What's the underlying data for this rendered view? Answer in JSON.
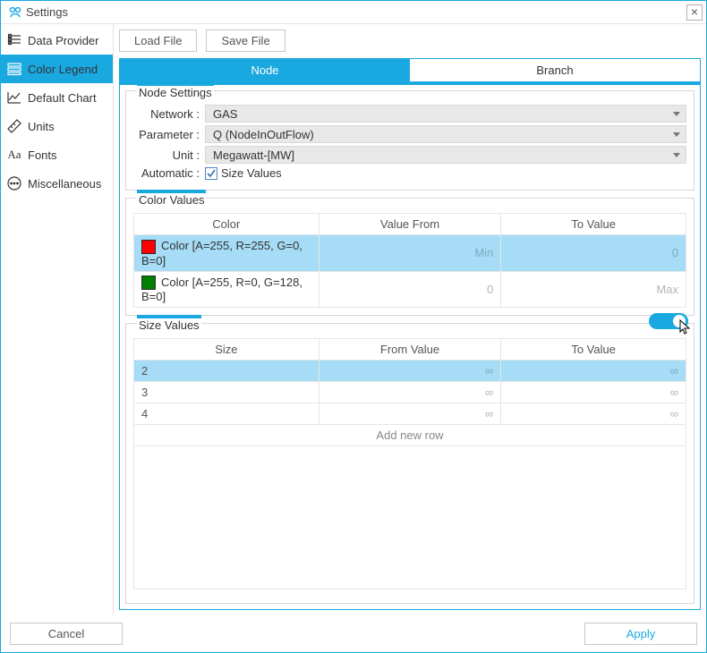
{
  "window": {
    "title": "Settings"
  },
  "sidebar": {
    "items": [
      {
        "label": "Data Provider"
      },
      {
        "label": "Color Legend"
      },
      {
        "label": "Default Chart"
      },
      {
        "label": "Units"
      },
      {
        "label": "Fonts"
      },
      {
        "label": "Miscellaneous"
      }
    ],
    "active_index": 1
  },
  "toolbar": {
    "load": "Load File",
    "save": "Save File"
  },
  "tabs": {
    "node": "Node",
    "branch": "Branch",
    "active": "node"
  },
  "node_settings": {
    "title": "Node Settings",
    "network_label": "Network :",
    "network_value": "GAS",
    "parameter_label": "Parameter :",
    "parameter_value": "Q (NodeInOutFlow)",
    "unit_label": "Unit :",
    "unit_value": "Megawatt-[MW]",
    "automatic_label": "Automatic :",
    "automatic_check_label": "Size Values",
    "automatic_checked": true
  },
  "color_values": {
    "title": "Color Values",
    "headers": {
      "color": "Color",
      "from": "Value From",
      "to": "To Value"
    },
    "rows": [
      {
        "swatch": "#ff0000",
        "name": "Color [A=255, R=255, G=0, B=0]",
        "from": "Min",
        "to": "0",
        "selected": true
      },
      {
        "swatch": "#008000",
        "name": "Color [A=255, R=0, G=128, B=0]",
        "from": "0",
        "to": "Max",
        "selected": false
      }
    ]
  },
  "size_values": {
    "title": "Size Values",
    "toggle_on": true,
    "headers": {
      "size": "Size",
      "from": "From Value",
      "to": "To Value"
    },
    "rows": [
      {
        "size": "2",
        "from": "∞",
        "to": "∞",
        "selected": true
      },
      {
        "size": "3",
        "from": "∞",
        "to": "∞",
        "selected": false
      },
      {
        "size": "4",
        "from": "∞",
        "to": "∞",
        "selected": false
      }
    ],
    "add_row": "Add new row"
  },
  "footer": {
    "cancel": "Cancel",
    "apply": "Apply"
  }
}
